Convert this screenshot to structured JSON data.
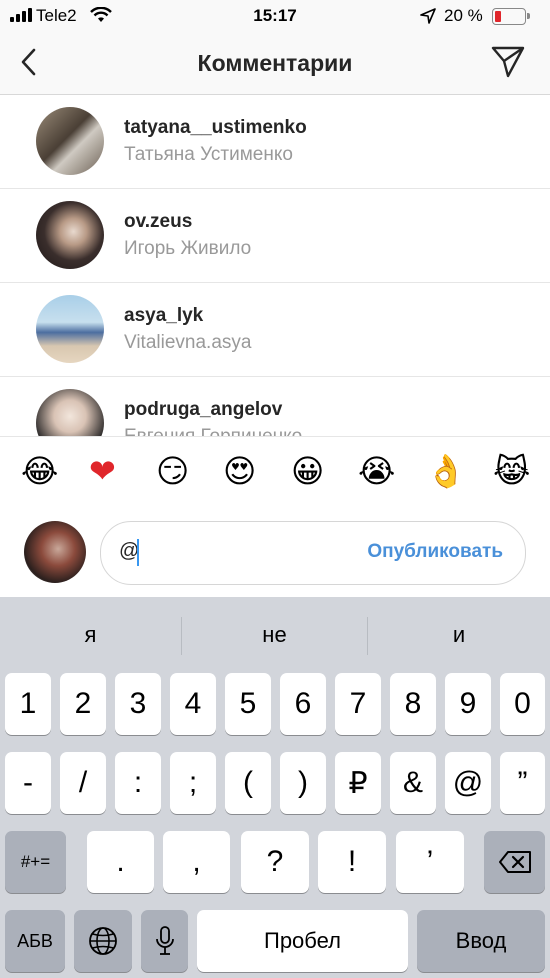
{
  "status": {
    "carrier": "Tele2",
    "time": "15:17",
    "battery": "20 %"
  },
  "header": {
    "title": "Комментарии",
    "back_icon": "chevron-left-icon",
    "send_icon": "paper-plane-icon"
  },
  "users": [
    {
      "username": "tatyana__ustimenko",
      "fullname": "Татьяна Устименко"
    },
    {
      "username": "ov.zeus",
      "fullname": "Игорь Живило"
    },
    {
      "username": "asya_lyk",
      "fullname": "Vitalievna.asya"
    },
    {
      "username": "podruga_angelov",
      "fullname": "Евгения Горпиненко"
    }
  ],
  "emojis": [
    "😂",
    "❤️",
    "😏",
    "😍",
    "😀",
    "😭",
    "👌",
    "😹"
  ],
  "composer": {
    "value": "@",
    "publish_label": "Опубликовать"
  },
  "keyboard": {
    "suggestions": [
      "я",
      "не",
      "и"
    ],
    "row1": [
      "1",
      "2",
      "3",
      "4",
      "5",
      "6",
      "7",
      "8",
      "9",
      "0"
    ],
    "row2": [
      "-",
      "/",
      ":",
      ";",
      "(",
      ")",
      "₽",
      "&",
      "@",
      "”"
    ],
    "row3": [
      ".",
      ",",
      "?",
      "!",
      "’"
    ],
    "shift_label": "#+=",
    "abc_label": "АБВ",
    "space_label": "Пробел",
    "return_label": "Ввод"
  },
  "colors": {
    "accent": "#3897f0",
    "keyboard_bg": "#d2d5db"
  }
}
